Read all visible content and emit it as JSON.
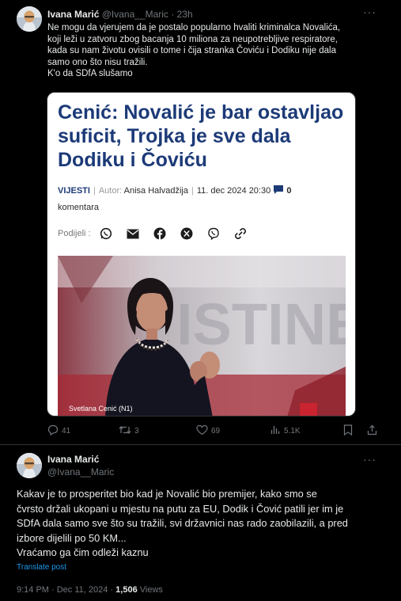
{
  "tweet1": {
    "author_name": "Ivana Marić",
    "author_handle": "@Ivana__Maric",
    "time_ago": "23h",
    "meta_sep": " · ",
    "more_label": "···",
    "text_lines": [
      "Ne mogu da vjerujem da je postalo popularno hvaliti kriminalca Novalića,",
      "koji leži u zatvoru zbog bacanja 10 miliona za neupotrebljive respiratore,",
      "kada su nam životu ovisili o tome i čija stranka Čoviću i Dodiku nije dala",
      "samo ono što nisu tražili.",
      "K'o da SDfA slušamo"
    ],
    "article": {
      "title": "Cenić: Novalić je bar ostavljao suficit, Trojka je sve dala Dodiku i Čoviću",
      "category": "VIJESTI",
      "author_label": "Autor:",
      "author": "Anisa Halvadžija",
      "date": "11. dec 2024",
      "time": "20:30",
      "comments_count": "0",
      "comments_label": "komentara",
      "share_label": "Podijeli :",
      "caption": "Svetlana Cenić (N1)",
      "backdrop_text": "ISTINE"
    },
    "stats": {
      "replies": "41",
      "reposts": "3",
      "likes": "69",
      "views": "5.1K"
    }
  },
  "tweet2": {
    "author_name": "Ivana Marić",
    "author_handle": "@Ivana__Maric",
    "more_label": "···",
    "text_lines": [
      "Kakav je to prosperitet bio kad je Novalić bio premijer, kako smo se",
      "čvrsto držali ukopani u mjestu na putu za EU, Dodik i Čović patili jer im je",
      "SDfA dala samo sve što su tražili, svi državnici nas rado zaobilazili, a pred",
      "izbore dijelili po 50 KM...",
      "Vraćamo ga čim odleži kaznu"
    ],
    "translate_label": "Translate post",
    "time": "9:14 PM · Dec 11, 2024",
    "dot": " · ",
    "views_count": "1,506",
    "views_label": "Views"
  },
  "colors": {
    "background": "#000000",
    "text": "#e7e9ea",
    "muted": "#71767b",
    "link": "#1d9bf0",
    "article_title": "#1c3a78"
  }
}
